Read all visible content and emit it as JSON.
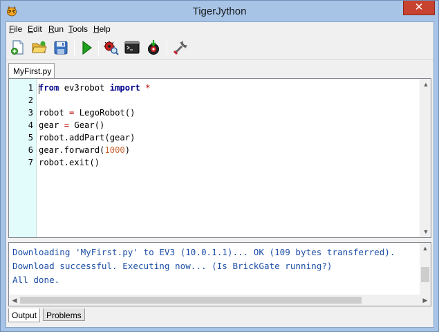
{
  "window": {
    "title": "TigerJython",
    "close_symbol": "✕",
    "accent": "#c7432f"
  },
  "menu": [
    {
      "label": "File",
      "mnemonic": "F",
      "rest": "ile"
    },
    {
      "label": "Edit",
      "mnemonic": "E",
      "rest": "dit"
    },
    {
      "label": "Run",
      "mnemonic": "R",
      "rest": "un"
    },
    {
      "label": "Tools",
      "mnemonic": "T",
      "rest": "ools"
    },
    {
      "label": "Help",
      "mnemonic": "H",
      "rest": "elp"
    }
  ],
  "toolbar": {
    "icons": [
      "new-file-icon",
      "open-file-icon",
      "save-icon",
      "run-icon",
      "debug-icon",
      "console-icon",
      "download-to-robot-icon",
      "settings-tools-icon"
    ]
  },
  "editor": {
    "tab_label": "MyFirst.py",
    "line_numbers": [
      "1",
      "2",
      "3",
      "4",
      "5",
      "6",
      "7"
    ],
    "lines": [
      [
        {
          "t": "from",
          "c": "kw"
        },
        {
          "t": " ev3robot ",
          "c": ""
        },
        {
          "t": "import",
          "c": "kw"
        },
        {
          "t": " ",
          "c": ""
        },
        {
          "t": "*",
          "c": "op"
        }
      ],
      [],
      [
        {
          "t": "robot ",
          "c": ""
        },
        {
          "t": "=",
          "c": "op"
        },
        {
          "t": " LegoRobot()",
          "c": ""
        }
      ],
      [
        {
          "t": "gear ",
          "c": ""
        },
        {
          "t": "=",
          "c": "op"
        },
        {
          "t": " Gear()",
          "c": ""
        }
      ],
      [
        {
          "t": "robot.addPart(gear)",
          "c": ""
        }
      ],
      [
        {
          "t": "gear.forward(",
          "c": ""
        },
        {
          "t": "1000",
          "c": "num"
        },
        {
          "t": ")",
          "c": ""
        }
      ],
      [
        {
          "t": "robot.exit()",
          "c": ""
        }
      ]
    ]
  },
  "output": {
    "lines": [
      "Downloading 'MyFirst.py' to EV3 (10.0.1.1)... OK (109 bytes transferred).",
      "Download successful. Executing now... (Is BrickGate running?)",
      "All done."
    ],
    "text_color": "#1c4ea6"
  },
  "bottom_tabs": [
    {
      "label": "Output",
      "active": true
    },
    {
      "label": "Problems",
      "active": false
    }
  ]
}
